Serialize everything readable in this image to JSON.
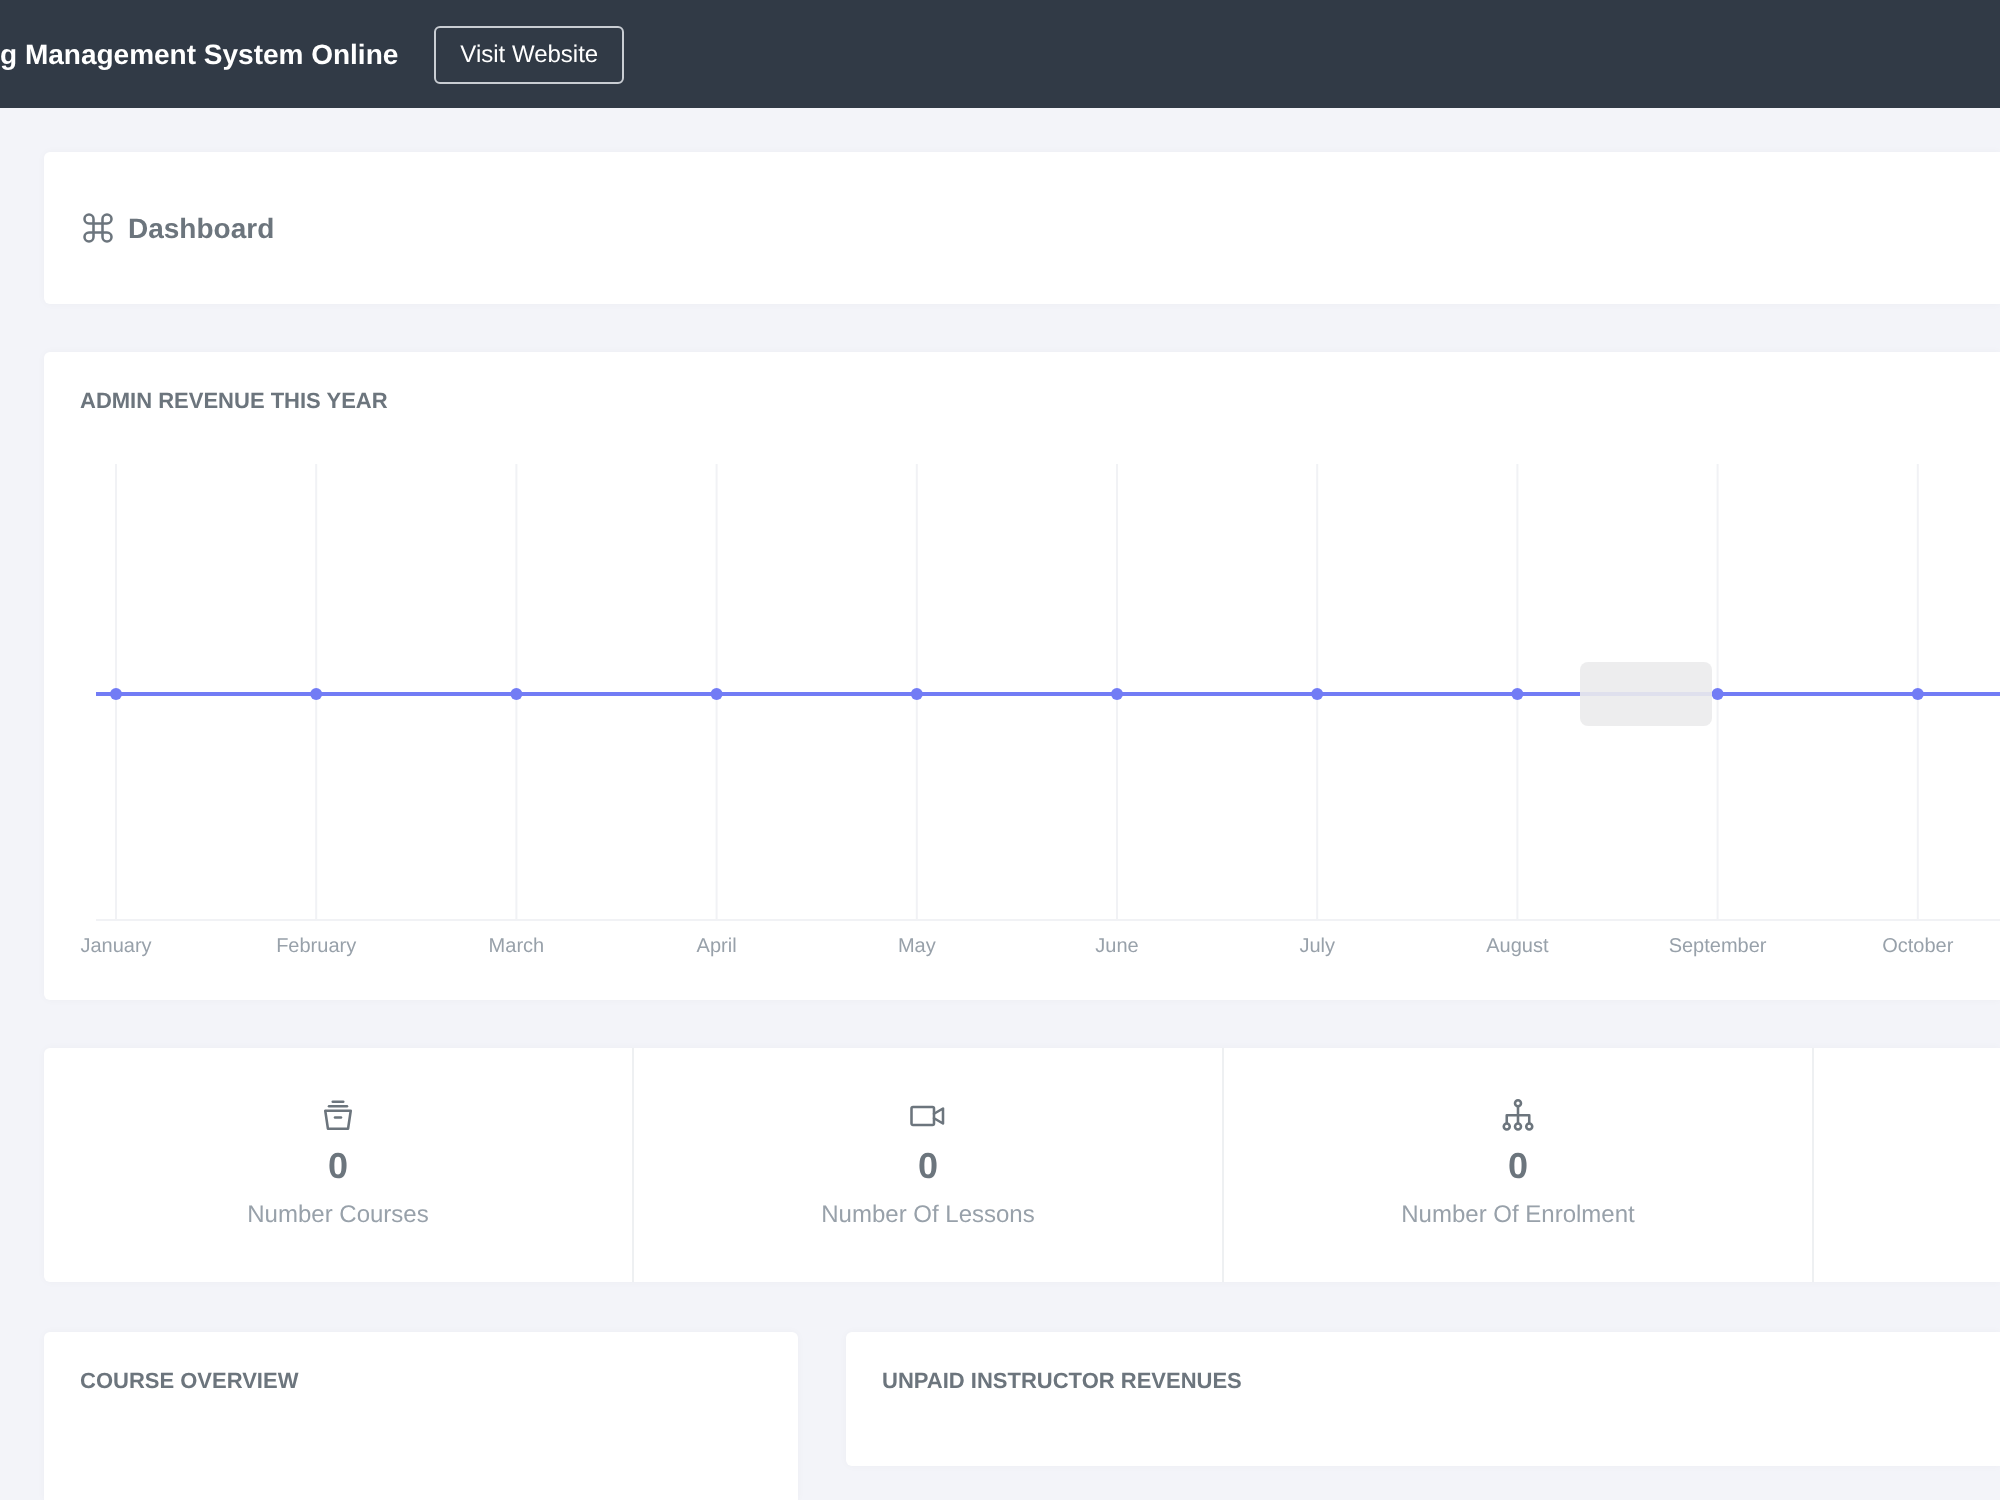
{
  "topbar": {
    "title": "g Management System Online",
    "button": "Visit Website"
  },
  "page_header": {
    "title": "Dashboard"
  },
  "revenue_chart": {
    "title": "ADMIN REVENUE THIS YEAR",
    "months": [
      "January",
      "February",
      "March",
      "April",
      "May",
      "June",
      "July",
      "August",
      "September",
      "October"
    ]
  },
  "stats": [
    {
      "value": "0",
      "label": "Number Courses"
    },
    {
      "value": "0",
      "label": "Number Of Lessons"
    },
    {
      "value": "0",
      "label": "Number Of Enrolment"
    }
  ],
  "panels": [
    {
      "title": "COURSE OVERVIEW"
    },
    {
      "title": "UNPAID INSTRUCTOR REVENUES"
    }
  ]
}
